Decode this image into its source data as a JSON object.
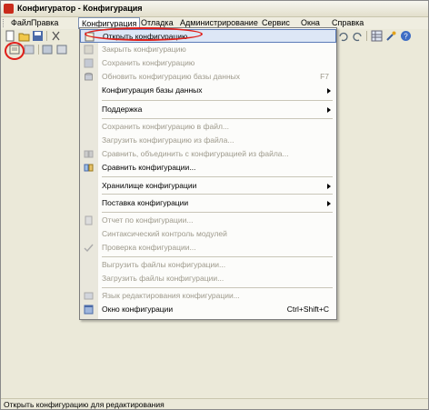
{
  "window": {
    "title": "Конфигуратор - Конфигурация"
  },
  "menubar": {
    "items": [
      {
        "label": "Файл",
        "active": false
      },
      {
        "label": "Правка",
        "active": false
      },
      {
        "label": "Конфигурация",
        "active": true
      },
      {
        "label": "Отладка",
        "active": false
      },
      {
        "label": "Администрирование",
        "active": false
      },
      {
        "label": "Сервис",
        "active": false
      },
      {
        "label": "Окна",
        "active": false
      },
      {
        "label": "Справка",
        "active": false
      }
    ]
  },
  "toolbar": {
    "icons": [
      "new-icon",
      "open-icon",
      "save-icon",
      "cut-icon",
      "open-configuration-icon",
      "properties-icon",
      "window-icon",
      "help-icon"
    ]
  },
  "configuration_menu": {
    "items": [
      {
        "label": "Открыть конфигурацию",
        "shortcut": "",
        "submenu": false,
        "enabled": true,
        "highlighted": true,
        "icon": "open-config-icon"
      },
      {
        "label": "Закрыть конфигурацию",
        "shortcut": "",
        "submenu": false,
        "enabled": false,
        "icon": "close-config-icon"
      },
      {
        "label": "Сохранить конфигурацию",
        "shortcut": "",
        "submenu": false,
        "enabled": false,
        "icon": "save-config-icon"
      },
      {
        "label": "Обновить конфигурацию базы данных",
        "shortcut": "F7",
        "submenu": false,
        "enabled": false,
        "icon": "update-db-icon"
      },
      {
        "label": "Конфигурация базы данных",
        "shortcut": "",
        "submenu": true,
        "enabled": true,
        "icon": ""
      },
      {
        "separator": true
      },
      {
        "label": "Поддержка",
        "shortcut": "",
        "submenu": true,
        "enabled": true,
        "icon": ""
      },
      {
        "separator": true
      },
      {
        "label": "Сохранить конфигурацию в файл...",
        "shortcut": "",
        "submenu": false,
        "enabled": false,
        "icon": ""
      },
      {
        "label": "Загрузить конфигурацию из файла...",
        "shortcut": "",
        "submenu": false,
        "enabled": false,
        "icon": ""
      },
      {
        "label": "Сравнить, объединить с конфигурацией из файла...",
        "shortcut": "",
        "submenu": false,
        "enabled": false,
        "icon": "compare-merge-icon"
      },
      {
        "label": "Сравнить конфигурации...",
        "shortcut": "",
        "submenu": false,
        "enabled": true,
        "icon": "compare-icon"
      },
      {
        "separator": true
      },
      {
        "label": "Хранилище конфигурации",
        "shortcut": "",
        "submenu": true,
        "enabled": true,
        "icon": ""
      },
      {
        "separator": true
      },
      {
        "label": "Поставка конфигурации",
        "shortcut": "",
        "submenu": true,
        "enabled": true,
        "icon": ""
      },
      {
        "separator": true
      },
      {
        "label": "Отчет по конфигурации...",
        "shortcut": "",
        "submenu": false,
        "enabled": false,
        "icon": "report-icon"
      },
      {
        "label": "Синтаксический контроль модулей",
        "shortcut": "",
        "submenu": false,
        "enabled": false,
        "icon": ""
      },
      {
        "label": "Проверка конфигурации...",
        "shortcut": "",
        "submenu": false,
        "enabled": false,
        "icon": "check-icon"
      },
      {
        "separator": true
      },
      {
        "label": "Выгрузить файлы конфигурации...",
        "shortcut": "",
        "submenu": false,
        "enabled": false,
        "icon": ""
      },
      {
        "label": "Загрузить файлы конфигурации...",
        "shortcut": "",
        "submenu": false,
        "enabled": false,
        "icon": ""
      },
      {
        "separator": true
      },
      {
        "label": "Язык редактирования конфигурации...",
        "shortcut": "",
        "submenu": false,
        "enabled": false,
        "icon": "language-icon"
      },
      {
        "label": "Окно конфигурации",
        "shortcut": "Ctrl+Shift+C",
        "submenu": false,
        "enabled": true,
        "icon": "config-window-icon"
      }
    ]
  },
  "statusbar": {
    "text": "Открыть конфигурацию для редактирования"
  },
  "colors": {
    "highlight": "#dde7f6",
    "highlight_border": "#5b7bb8",
    "annotation_red": "#e0201b",
    "disabled_text": "#9e9a8c"
  }
}
